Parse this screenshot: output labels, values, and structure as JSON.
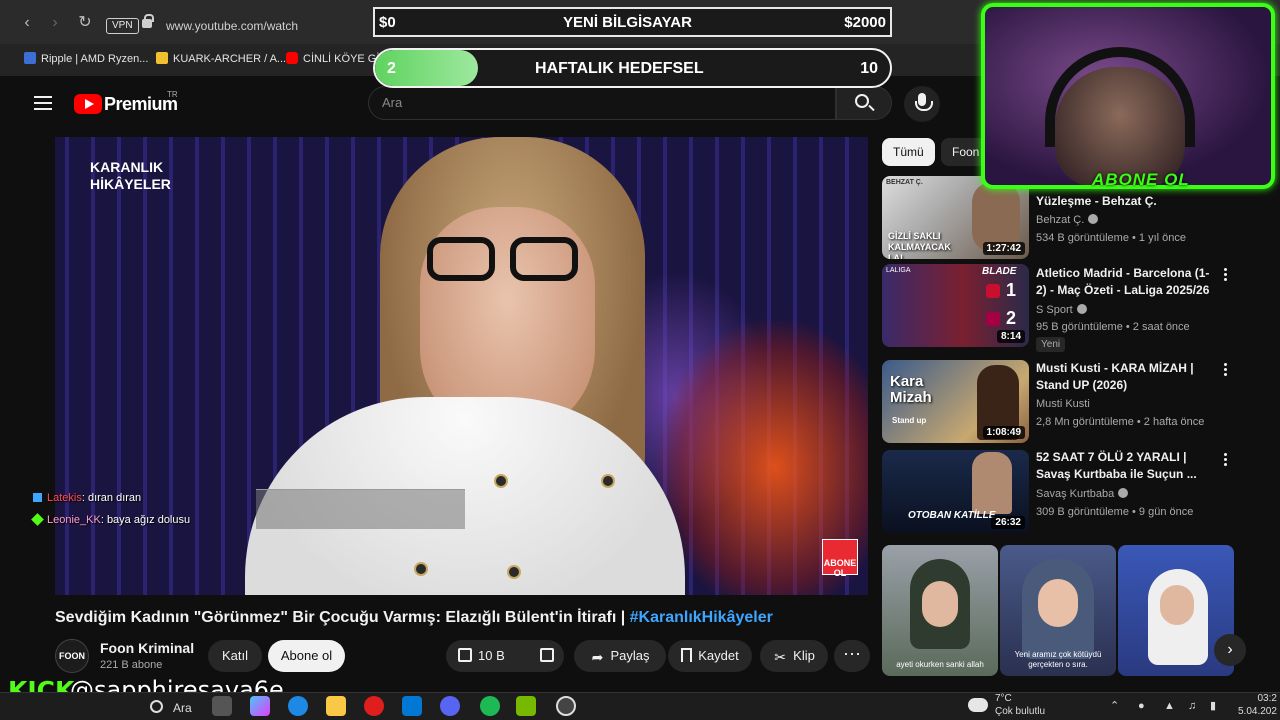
{
  "browser": {
    "url": "www.youtube.com/watch",
    "vpn": "VPN",
    "bookmarks": [
      "Ripple | AMD Ryzen...",
      "KUARK-ARCHER / A...",
      "CİNLİ KÖYE GİR"
    ]
  },
  "overlay": {
    "goal1": {
      "left": "$0",
      "title": "YENİ BİLGİSAYAR",
      "right": "$2000"
    },
    "goal2": {
      "current": "2",
      "title": "HAFTALIK HEDEFSEL",
      "target": "10",
      "progress": 0.2
    },
    "abone": "ABONE OL",
    "kick": "KICK",
    "handle": "@sapphiresava6e"
  },
  "youtube": {
    "brand": "Premium",
    "region": "TR",
    "search_placeholder": "Ara"
  },
  "video": {
    "show_title": "KARANLIK HİKÂYELER",
    "abone_logo": "ABONE OL",
    "title": "Sevdiğim Kadının \"Görünmez\" Bir Çocuğu Varmış: Elazığlı Bülent'in İtirafı | ",
    "hashtag": "#KaranlıkHikâyeler",
    "channel": "Foon Kriminal",
    "channel_avatar": "FOON",
    "subscribers": "221 B abone",
    "join": "Katıl",
    "subscribe": "Abone ol",
    "likes": "10 B",
    "share": "Paylaş",
    "save": "Kaydet",
    "clip": "Klip"
  },
  "chat": [
    {
      "user": "Latekis",
      "message": ": dıran dıran",
      "user_color": "#ff4d4d"
    },
    {
      "user": "Leonie_KK",
      "message": ": baya ağız dolusu",
      "user_color": "#ff9ecf"
    }
  ],
  "sidebar": {
    "chips": [
      "Tümü",
      "Foon"
    ],
    "videos": [
      {
        "title": "Yüzleşme - Behzat Ç.",
        "channel": "Behzat Ç.",
        "meta": "534 B görüntüleme • 1 yıl önce",
        "duration": "1:27:42",
        "thumb_text": "GİZLİ SAKLI KALMAYACAK LA!",
        "thumb_top": "BEHZAT Ç."
      },
      {
        "title": "Atletico Madrid - Barcelona (1-2) - Maç Özeti - LaLiga 2025/26",
        "channel": "S Sport",
        "meta": "95 B görüntüleme • 2 saat önce",
        "duration": "8:14",
        "badge": "Yeni",
        "thumb_text": "BLADE",
        "score_a": "1",
        "score_b": "2",
        "thumb_top": "LALIGA"
      },
      {
        "title": "Musti Kusti - KARA MİZAH | Stand UP (2026)",
        "channel": "Musti Kusti",
        "meta": "2,8 Mn görüntüleme • 2 hafta önce",
        "duration": "1:08:49",
        "thumb_text": "Kara Mizah",
        "thumb_sub": "Stand up"
      },
      {
        "title": "52 SAAT 7 ÖLÜ 2 YARALI | Savaş Kurtbaba ile Suçun ...",
        "channel": "Savaş Kurtbaba",
        "meta": "309 B görüntüleme • 9 gün önce",
        "duration": "26:32",
        "thumb_text": "OTOBAN KATİLLE"
      }
    ],
    "shorts": [
      {
        "caption": "ayeti okurken sanki allah"
      },
      {
        "caption": "Yeni aramız çok kötüydü gerçekten o sıra."
      },
      {
        "caption": ""
      }
    ]
  },
  "taskbar": {
    "search": "Ara",
    "temp": "7°C",
    "weather": "Çok bulutlu",
    "time": "03:2",
    "date": "5.04.202"
  },
  "colors": {
    "accent_green": "#39ff14",
    "kick_green": "#53fc18",
    "youtube_red": "#ff0000",
    "link_blue": "#3ea6ff"
  }
}
